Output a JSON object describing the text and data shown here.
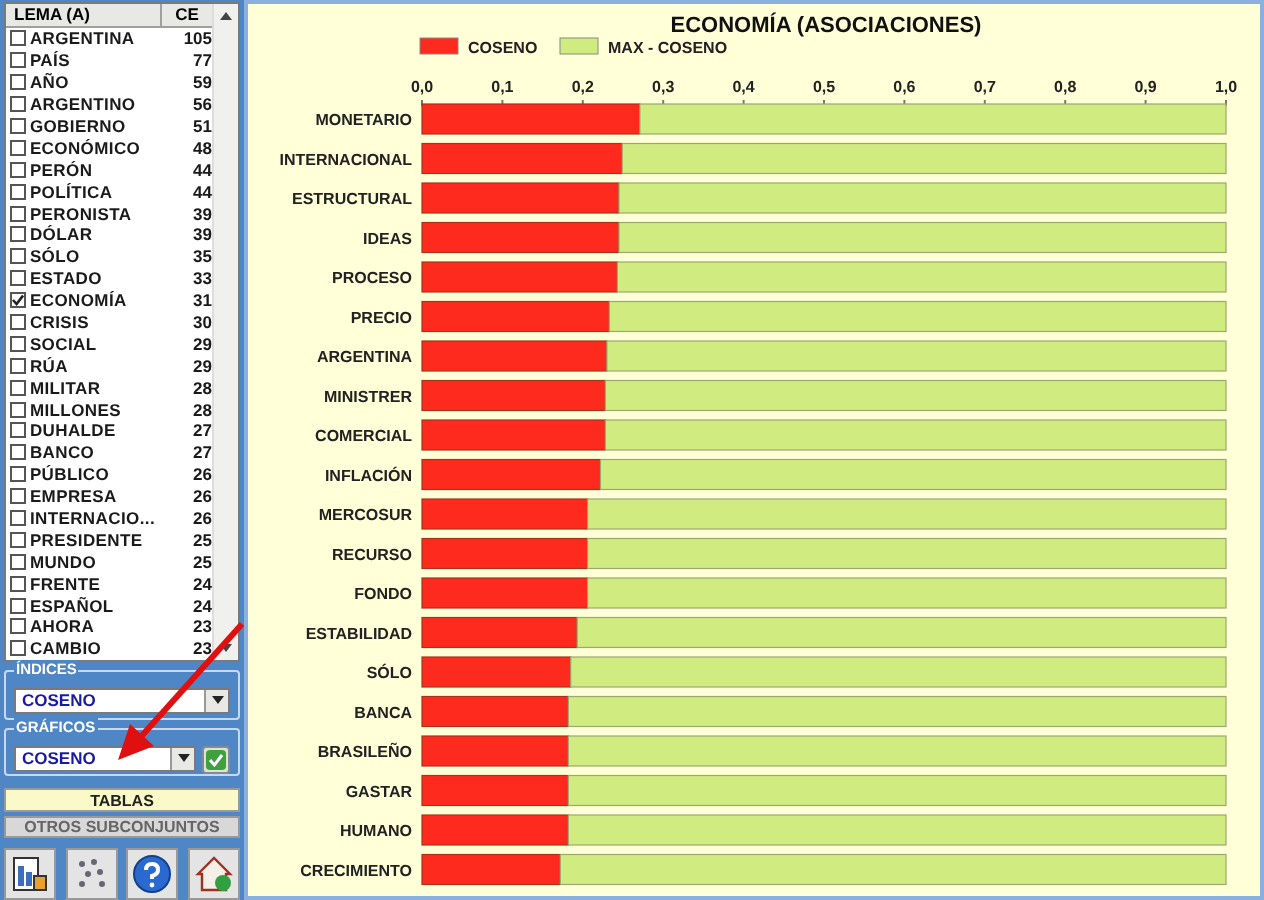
{
  "word_list": {
    "columns": [
      "LEMA (A)",
      "CE"
    ],
    "rows": [
      {
        "lema": "ARGENTINA",
        "ce": "105",
        "checked": false
      },
      {
        "lema": "PAÍS",
        "ce": "77",
        "checked": false
      },
      {
        "lema": "AÑO",
        "ce": "59",
        "checked": false
      },
      {
        "lema": "ARGENTINO",
        "ce": "56",
        "checked": false
      },
      {
        "lema": "GOBIERNO",
        "ce": "51",
        "checked": false
      },
      {
        "lema": "ECONÓMICO",
        "ce": "48",
        "checked": false
      },
      {
        "lema": "PERÓN",
        "ce": "44",
        "checked": false
      },
      {
        "lema": "POLÍTICA",
        "ce": "44",
        "checked": false
      },
      {
        "lema": "PERONISTA",
        "ce": "39",
        "checked": false
      },
      {
        "lema": "DÓLAR",
        "ce": "39",
        "checked": false
      },
      {
        "lema": "SÓLO",
        "ce": "35",
        "checked": false
      },
      {
        "lema": "ESTADO",
        "ce": "33",
        "checked": false
      },
      {
        "lema": "ECONOMÍA",
        "ce": "31",
        "checked": true
      },
      {
        "lema": "CRISIS",
        "ce": "30",
        "checked": false
      },
      {
        "lema": "SOCIAL",
        "ce": "29",
        "checked": false
      },
      {
        "lema": "RÚA",
        "ce": "29",
        "checked": false
      },
      {
        "lema": "MILITAR",
        "ce": "28",
        "checked": false
      },
      {
        "lema": "MILLONES",
        "ce": "28",
        "checked": false
      },
      {
        "lema": "DUHALDE",
        "ce": "27",
        "checked": false
      },
      {
        "lema": "BANCO",
        "ce": "27",
        "checked": false
      },
      {
        "lema": "PÚBLICO",
        "ce": "26",
        "checked": false
      },
      {
        "lema": "EMPRESA",
        "ce": "26",
        "checked": false
      },
      {
        "lema": "INTERNACIO...",
        "ce": "26",
        "checked": false
      },
      {
        "lema": "PRESIDENTE",
        "ce": "25",
        "checked": false
      },
      {
        "lema": "MUNDO",
        "ce": "25",
        "checked": false
      },
      {
        "lema": "FRENTE",
        "ce": "24",
        "checked": false
      },
      {
        "lema": "ESPAÑOL",
        "ce": "24",
        "checked": false
      },
      {
        "lema": "AHORA",
        "ce": "23",
        "checked": false
      },
      {
        "lema": "CAMBIO",
        "ce": "23",
        "checked": false
      }
    ]
  },
  "indices": {
    "label": "ÍNDICES",
    "value": "COSENO"
  },
  "graficos": {
    "label": "GRÁFICOS",
    "value": "COSENO"
  },
  "buttons": [
    "TABLAS",
    "OTROS SUBCONJUNTOS"
  ],
  "chart": {
    "chart_data": {
      "type": "bar",
      "orientation": "horizontal",
      "stacked": true,
      "title": "ECONOMÍA (ASOCIACIONES)",
      "categories": [
        "MONETARIO",
        "INTERNACIONAL",
        "ESTRUCTURAL",
        "IDEAS",
        "PROCESO",
        "PRECIO",
        "ARGENTINA",
        "MINISTRER",
        "COMERCIAL",
        "INFLACIÓN",
        "MERCOSUR",
        "RECURSO",
        "FONDO",
        "ESTABILIDAD",
        "SÓLO",
        "BANCA",
        "BRASILEÑO",
        "GASTAR",
        "HUMANO",
        "CRECIMIENTO"
      ],
      "series": [
        {
          "name": "COSENO",
          "color": "#ff2a1e",
          "values": [
            0.271,
            0.249,
            0.245,
            0.245,
            0.243,
            0.233,
            0.23,
            0.228,
            0.228,
            0.222,
            0.206,
            0.206,
            0.206,
            0.193,
            0.185,
            0.182,
            0.182,
            0.182,
            0.182,
            0.172
          ]
        },
        {
          "name": "MAX - COSENO",
          "color": "#d0ec80",
          "values": [
            0.729,
            0.751,
            0.755,
            0.755,
            0.757,
            0.767,
            0.77,
            0.772,
            0.772,
            0.778,
            0.794,
            0.794,
            0.794,
            0.807,
            0.815,
            0.818,
            0.818,
            0.818,
            0.818,
            0.828
          ]
        }
      ],
      "xlim": [
        0,
        1
      ],
      "xticks": [
        {
          "value": 0,
          "label": "0,0"
        },
        {
          "value": 0.1,
          "label": "0,1"
        },
        {
          "value": 0.2,
          "label": "0,2"
        },
        {
          "value": 0.3,
          "label": "0,3"
        },
        {
          "value": 0.4,
          "label": "0,4"
        },
        {
          "value": 0.5,
          "label": "0,5"
        },
        {
          "value": 0.6,
          "label": "0,6"
        },
        {
          "value": 0.7,
          "label": "0,7"
        },
        {
          "value": 0.8,
          "label": "0,8"
        },
        {
          "value": 0.9,
          "label": "0,9"
        },
        {
          "value": 1,
          "label": "1,0"
        }
      ]
    }
  }
}
